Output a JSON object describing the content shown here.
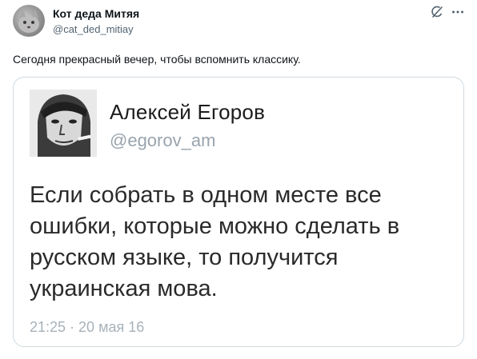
{
  "post": {
    "author": {
      "name": "Кот деда Митяя",
      "handle": "@cat_ded_mitiay"
    },
    "icons": {
      "grok": "grok-icon",
      "more": "more-icon"
    },
    "text": "Сегодня прекрасный вечер, чтобы вспомнить классику."
  },
  "quoted": {
    "author": {
      "name": "Алексей Егоров",
      "handle": "@egorov_am"
    },
    "text": "Если собрать в одном месте все ошибки, которые можно сделать в русском языке, то получится украинская мова.",
    "timestamp": "21:25 · 20 мая 16"
  },
  "colors": {
    "text_primary": "#0f1419",
    "text_secondary": "#536471",
    "border": "#cfd9de",
    "quote_meta": "#a7b2ba"
  }
}
